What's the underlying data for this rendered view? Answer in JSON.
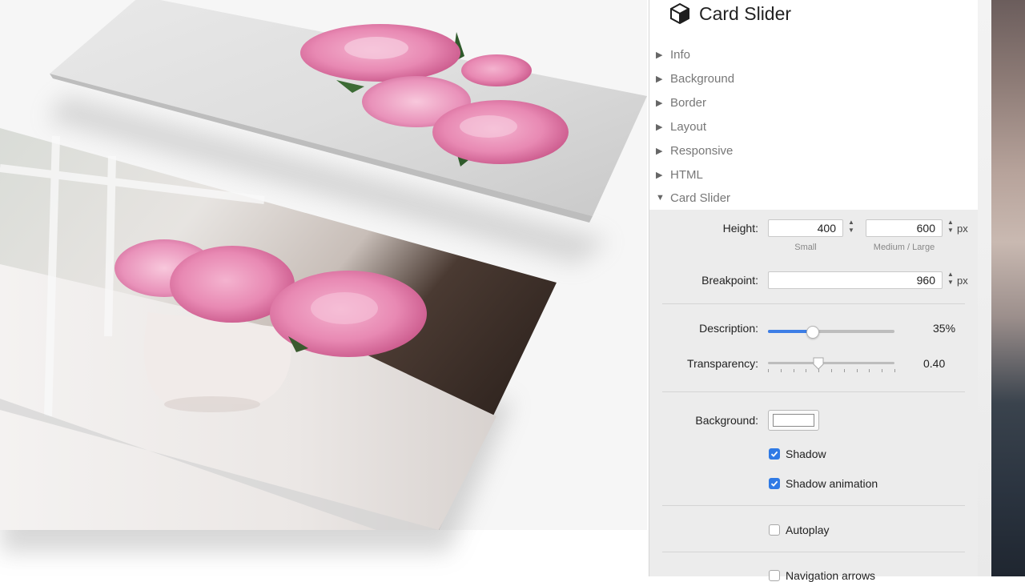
{
  "inspector": {
    "title": "Card Slider",
    "sections": [
      "Info",
      "Background",
      "Border",
      "Layout",
      "Responsive",
      "HTML",
      "Card Slider"
    ],
    "expanded_section": "Card Slider",
    "height": {
      "label": "Height:",
      "small_value": "400",
      "small_caption": "Small",
      "large_value": "600",
      "large_caption": "Medium / Large",
      "unit": "px"
    },
    "breakpoint": {
      "label": "Breakpoint:",
      "value": "960",
      "unit": "px"
    },
    "description": {
      "label": "Description:",
      "value_text": "35%",
      "level": 0.35
    },
    "transparency": {
      "label": "Transparency:",
      "value_text": "0.40",
      "level": 0.4
    },
    "background": {
      "label": "Background:",
      "color": "#ffffff"
    },
    "checkboxes": [
      {
        "label": "Shadow",
        "checked": true
      },
      {
        "label": "Shadow animation",
        "checked": true
      },
      {
        "label": "Autoplay",
        "checked": false
      },
      {
        "label": "Navigation arrows",
        "checked": false
      }
    ]
  },
  "colors": {
    "accent": "#3d7ee6",
    "checkbox": "#2f7ae5"
  },
  "preview": {
    "cards": [
      "peony-flowers-card",
      "peony-vase-card"
    ]
  }
}
